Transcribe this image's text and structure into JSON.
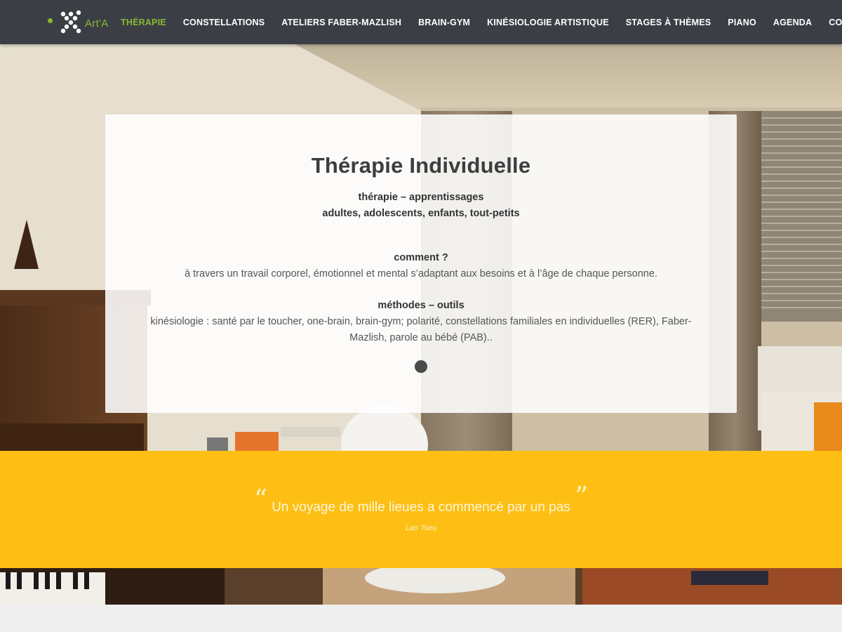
{
  "brand": {
    "logo_text": "Art'A",
    "accent_color": "#8ab832"
  },
  "nav": {
    "items": [
      {
        "label": "Thérapie",
        "active": true
      },
      {
        "label": "Constellations",
        "active": false
      },
      {
        "label": "Ateliers Faber-Mazlish",
        "active": false
      },
      {
        "label": "Brain-Gym",
        "active": false
      },
      {
        "label": "Kinésiologie Artistique",
        "active": false
      },
      {
        "label": "Stages à Thèmes",
        "active": false
      },
      {
        "label": "Piano",
        "active": false
      },
      {
        "label": "Agenda",
        "active": false
      },
      {
        "label": "Contact",
        "active": false
      }
    ]
  },
  "hero": {
    "title": "Thérapie Individuelle",
    "subtitle_line1": "thérapie – apprentissages",
    "subtitle_line2": "adultes, adolescents, enfants, tout-petits",
    "section1_heading": "comment ?",
    "section1_text": "à travers un travail corporel, émotionnel et mental s’adaptant aux besoins et à l’âge de chaque personne.",
    "section2_heading": "méthodes – outils",
    "section2_text": "kinésiologie : santé par le toucher, one-brain, brain-gym;  polarité, constellations familiales en individuelles (RER), Faber-Mazlish, parole au bébé (PAB).."
  },
  "quote": {
    "open_mark": "“",
    "close_mark": "”",
    "text": "Un voyage de mille lieues a commencé par un pas",
    "author": "Lao Tseu",
    "band_color": "#fdbf14"
  },
  "colors": {
    "nav_bg": "#3b3f45",
    "quote_band": "#fdbf14"
  }
}
